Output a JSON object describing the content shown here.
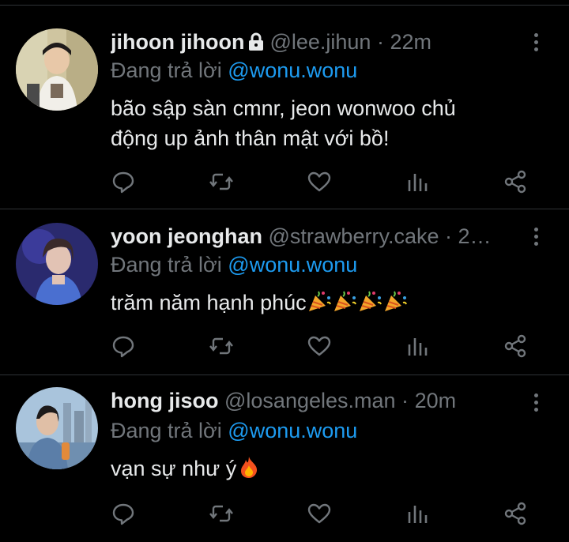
{
  "colors": {
    "background": "#000000",
    "text": "#e7e9ea",
    "muted": "#71767b",
    "link": "#1d9bf0",
    "divider": "#2f3336"
  },
  "tweets": [
    {
      "name": "jihoon jihoon",
      "protected": true,
      "handle": "@lee.jihun",
      "separator": "·",
      "time": "22m",
      "reply_prefix": "Đang trả lời",
      "reply_to": "@wonu.wonu",
      "text_line1": "bão sập sàn cmnr, jeon wonwoo chủ",
      "text_line2": "động up ảnh thân mật với bồ!",
      "emojis": []
    },
    {
      "name": "yoon jeonghan",
      "protected": false,
      "handle": "@strawberry.cake",
      "separator": "·",
      "time": "2…",
      "reply_prefix": "Đang trả lời",
      "reply_to": "@wonu.wonu",
      "text_line1": "trăm năm hạnh phúc",
      "emojis": [
        "party-popper",
        "party-popper",
        "party-popper",
        "party-popper"
      ]
    },
    {
      "name": "hong jisoo",
      "protected": false,
      "handle": "@losangeles.man",
      "separator": "·",
      "time": "20m",
      "reply_prefix": "Đang trả lời",
      "reply_to": "@wonu.wonu",
      "text_line1": "vạn sự như ý",
      "emojis": [
        "fire"
      ]
    }
  ],
  "icons": [
    "reply-icon",
    "retweet-icon",
    "like-icon",
    "analytics-icon",
    "share-icon",
    "more-options-icon",
    "lock-icon"
  ]
}
